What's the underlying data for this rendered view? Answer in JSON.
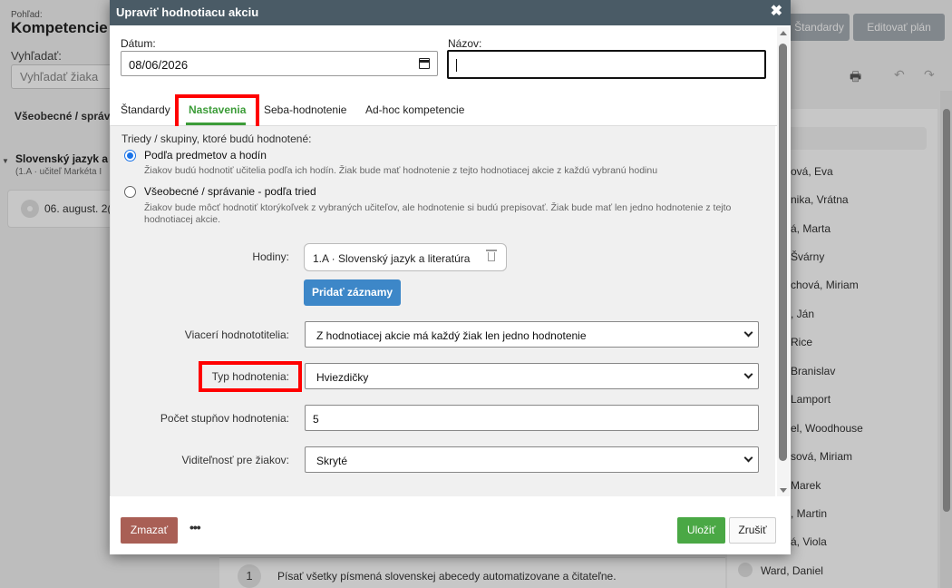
{
  "background": {
    "view_label": "Pohľad:",
    "title": "Kompetencie",
    "search_label": "Vyhľadať:",
    "search_placeholder": "Vyhľadať žiaka",
    "btn_standards": "Štandardy",
    "btn_edit_plan": "Editovať plán",
    "section_heading": "Všeobecné / správ",
    "subject": "Slovenský jazyk a",
    "subject_sub": "(1.A · učiteľ Markéta I",
    "date_card": "06. august. 2(",
    "students": [
      "ová, Eva",
      "nika, Vrátna",
      "á, Marta",
      "Švárny",
      "chová, Miriam",
      ", Ján",
      "Rice",
      "Branislav",
      "Lamport",
      "el, Woodhouse",
      "sová, Miriam",
      "Marek",
      ", Martin",
      "á, Viola",
      "Ward, Daniel"
    ],
    "task_number": "1",
    "task_text": "Písať všetky písmená slovenskej abecedy automatizovane a čitateľne."
  },
  "modal": {
    "title": "Upraviť hodnotiacu akciu",
    "close": "✖",
    "date_label": "Dátum:",
    "date_value": "08/06/2026",
    "name_label": "Názov:",
    "name_value": "",
    "tabs": [
      "Štandardy",
      "Nastavenia",
      "Seba-hodnotenie",
      "Ad-hoc kompetencie"
    ],
    "active_tab": "Nastavenia",
    "settings": {
      "groups_label": "Triedy / skupiny, ktoré budú hodnotené:",
      "option1_label": "Podľa predmetov a hodín",
      "option1_desc": "Žiakov budú hodnotiť učitelia podľa ich hodín. Žiak bude mať hodnotenie z tejto hodnotiacej akcie z každú vybranú hodinu",
      "option1_checked": true,
      "option2_label": "Všeobecné / správanie - podľa tried",
      "option2_desc_line1": "Žiakov bude môcť hodnotiť ktorýkoľvek z vybraných učiteľov, ale hodnotenie si budú prepisovať. Žiak bude mať len jedno hodnotenie z tejto",
      "option2_desc_line2": "hodnotiacej akcie.",
      "hours_label": "Hodiny:",
      "hours_chip": "1.A · Slovenský jazyk a literatúra",
      "add_records": "Pridať záznamy",
      "multiple_raters_label": "Viacerí hodnototitelia:",
      "multiple_raters_value": "Z hodnotiacej akcie má každý žiak len jedno hodnotenie",
      "rating_type_label": "Typ hodnotenia:",
      "rating_type_value": "Hviezdičky",
      "levels_label": "Počet stupňov hodnotenia:",
      "levels_value": "5",
      "visibility_label": "Viditeľnosť pre žiakov:",
      "visibility_value": "Skryté"
    },
    "footer": {
      "delete": "Zmazať",
      "more": "•••",
      "save": "Uložiť",
      "cancel": "Zrušiť"
    }
  },
  "colors": {
    "header_bg": "#4a5b66",
    "accent_green": "#3c9c38",
    "primary_blue": "#3d87c8",
    "danger": "#a95f55",
    "highlight": "#ff0000"
  }
}
